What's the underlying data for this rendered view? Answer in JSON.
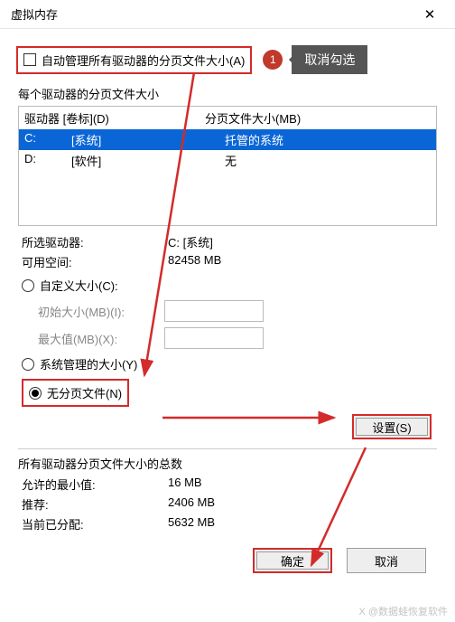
{
  "titlebar": {
    "title": "虚拟内存"
  },
  "auto": {
    "label": "自动管理所有驱动器的分页文件大小(A)",
    "badge": "1",
    "callout": "取消勾选"
  },
  "drives": {
    "section_label": "每个驱动器的分页文件大小",
    "hdr_drive": "驱动器 [卷标](D)",
    "hdr_size": "分页文件大小(MB)",
    "rows": [
      {
        "d": "C:",
        "l": "[系统]",
        "s": "托管的系统"
      },
      {
        "d": "D:",
        "l": "[软件]",
        "s": "无"
      }
    ]
  },
  "selected": {
    "label": "所选驱动器:",
    "value": "C:  [系统]"
  },
  "space": {
    "label": "可用空间:",
    "value": "82458 MB"
  },
  "radios": {
    "custom": "自定义大小(C):",
    "initial": "初始大小(MB)(I):",
    "max": "最大值(MB)(X):",
    "system": "系统管理的大小(Y)",
    "none": "无分页文件(N)"
  },
  "buttons": {
    "set": "设置(S)",
    "ok": "确定",
    "cancel": "取消"
  },
  "totals": {
    "section_label": "所有驱动器分页文件大小的总数",
    "min": {
      "k": "允许的最小值:",
      "v": "16 MB"
    },
    "rec": {
      "k": "推荐:",
      "v": "2406 MB"
    },
    "cur": {
      "k": "当前已分配:",
      "v": "5632 MB"
    }
  },
  "watermark": "X @数据蛙恢复软件"
}
